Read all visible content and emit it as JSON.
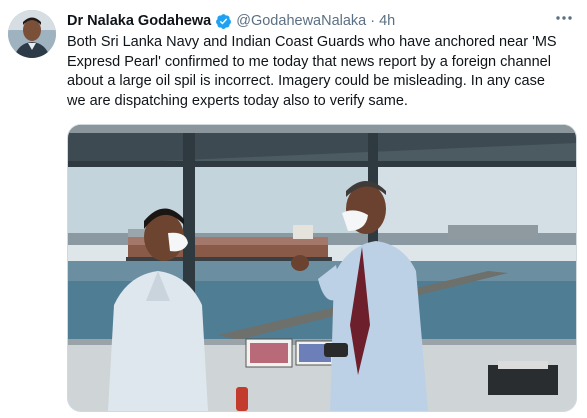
{
  "tweet": {
    "author_name": "Dr Nalaka Godahewa",
    "handle": "@GodahewaNalaka",
    "separator": "·",
    "time": "4h",
    "text_lines": [
      "Both Sri Lanka Navy and Indian Coast Guards who have anchored near 'MS",
      "Expresd  Pearl' confirmed to me today that news report by a foreign channel",
      "about a large oil spil is incorrect. Imagery could be misleading. In any case",
      "we are dispatching experts today also to verify same."
    ],
    "icons": {
      "avatar": "avatar-photo",
      "verified": "verified-badge-icon",
      "more": "more-options-icon"
    },
    "colors": {
      "verified": "#1da1f2",
      "secondary_text": "#5b7083"
    }
  }
}
